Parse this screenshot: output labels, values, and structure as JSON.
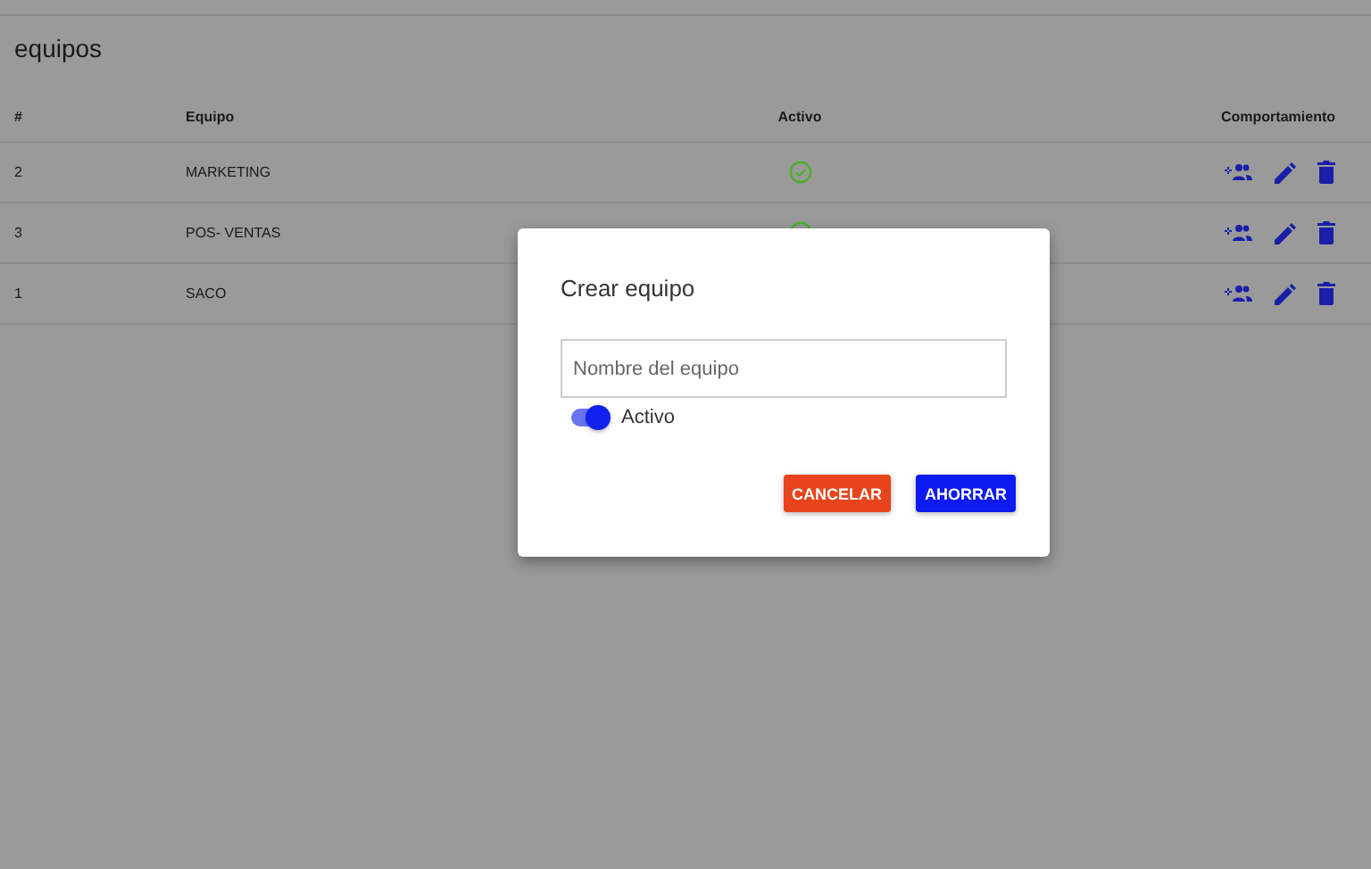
{
  "page": {
    "title": "equipos"
  },
  "table": {
    "columns": [
      "#",
      "Equipo",
      "Activo",
      "Comportamiento"
    ],
    "rows": [
      {
        "id": "2",
        "name": "MARKETING",
        "active": true
      },
      {
        "id": "3",
        "name": "POS- VENTAS",
        "active": true
      },
      {
        "id": "1",
        "name": "SACO"
      }
    ]
  },
  "dialog": {
    "title": "Crear equipo",
    "field": {
      "placeholder": "Nombre del equipo"
    },
    "toggle": {
      "label": "Activo",
      "on": true
    },
    "buttons": [
      {
        "label": "CANCELAR",
        "kind": "cancel"
      },
      {
        "label": "AHORRAR",
        "kind": "save"
      }
    ]
  }
}
